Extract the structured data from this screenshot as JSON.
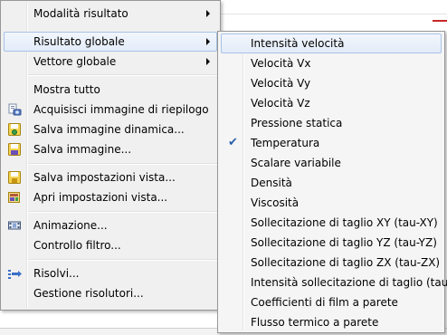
{
  "main_menu": {
    "items": [
      {
        "label": "Modalità risultato",
        "submenu": true
      },
      {
        "label": "Risultato globale",
        "submenu": true,
        "highlighted": true
      },
      {
        "label": "Vettore globale",
        "submenu": true
      },
      {
        "label": "Mostra tutto"
      },
      {
        "label": "Acquisisci immagine di riepilogo",
        "icon": "capture-summary-icon"
      },
      {
        "label": "Salva immagine dinamica...",
        "icon": "save-dynamic-image-icon"
      },
      {
        "label": "Salva immagine...",
        "icon": "save-image-icon"
      },
      {
        "label": "Salva impostazioni vista...",
        "icon": "save-view-settings-icon"
      },
      {
        "label": "Apri impostazioni vista...",
        "icon": "open-view-settings-icon"
      },
      {
        "label": "Animazione...",
        "icon": "film-icon"
      },
      {
        "label": "Controllo filtro..."
      },
      {
        "label": "Risolvi...",
        "icon": "solve-icon"
      },
      {
        "label": "Gestione risolutori..."
      }
    ]
  },
  "sub_menu": {
    "items": [
      {
        "label": "Intensità velocità",
        "highlighted": true
      },
      {
        "label": "Velocità Vx"
      },
      {
        "label": "Velocità Vy"
      },
      {
        "label": "Velocità Vz"
      },
      {
        "label": "Pressione statica"
      },
      {
        "label": "Temperatura",
        "checked": true
      },
      {
        "label": "Scalare variabile"
      },
      {
        "label": "Densità"
      },
      {
        "label": "Viscosità"
      },
      {
        "label": "Sollecitazione di taglio XY (tau-XY)"
      },
      {
        "label": "Sollecitazione di taglio YZ (tau-YZ)"
      },
      {
        "label": "Sollecitazione di taglio ZX (tau-ZX)"
      },
      {
        "label": "Intensità sollecitazione di taglio (tau)"
      },
      {
        "label": "Coefficienti di film a parete"
      },
      {
        "label": "Flusso termico a parete"
      }
    ],
    "check_glyph": "✔"
  },
  "colors": {
    "menu_bg": "#f0f0f0",
    "highlight_border": "#a8c2e6",
    "check": "#2a5ea8"
  }
}
